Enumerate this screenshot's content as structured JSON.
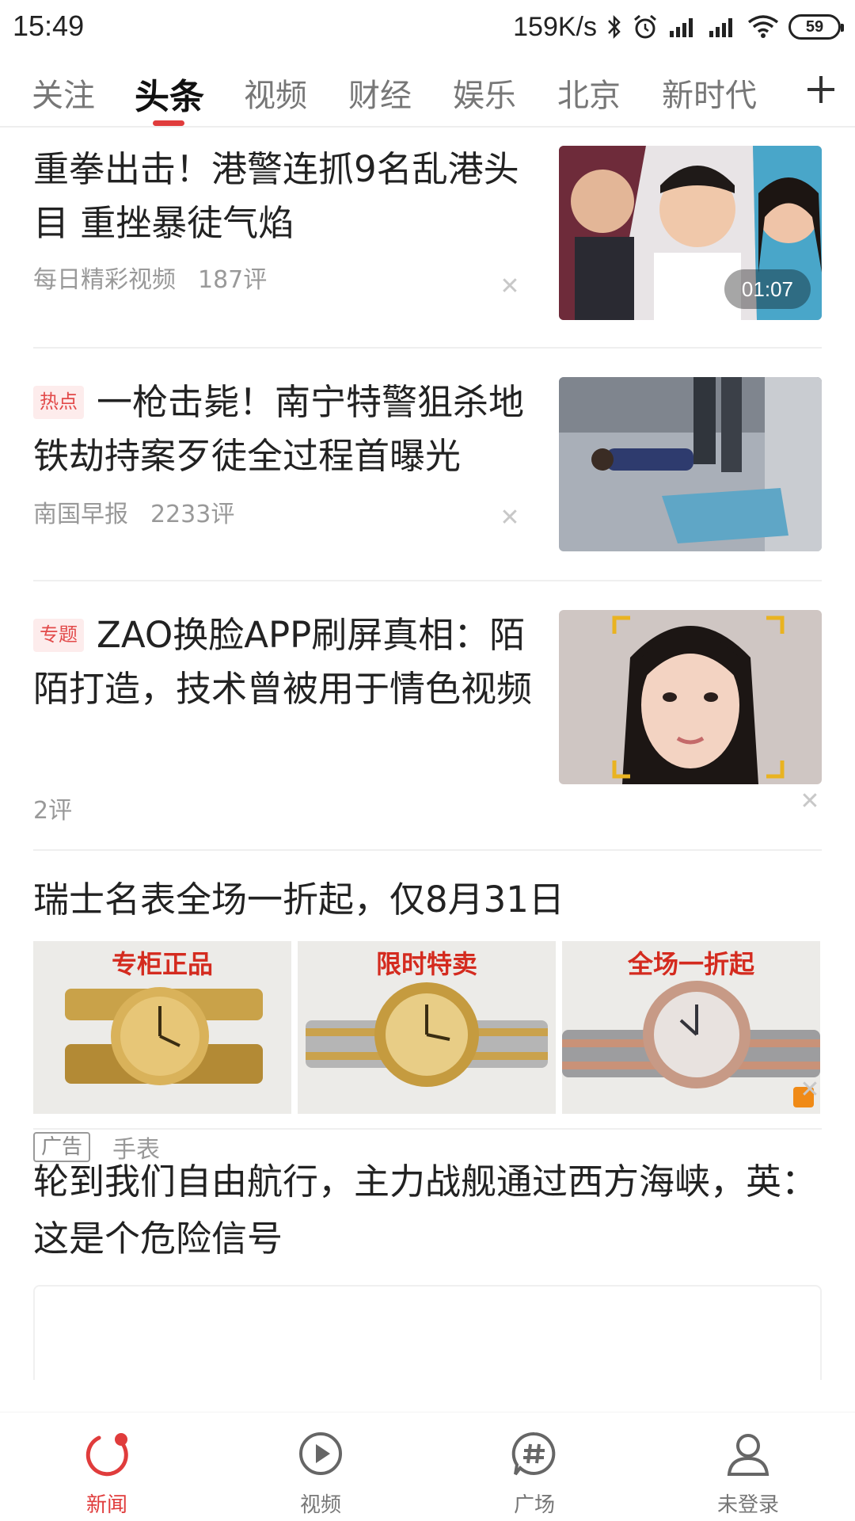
{
  "status_bar": {
    "time": "15:49",
    "net_speed": "159K/s",
    "battery": "59"
  },
  "tabs": [
    {
      "label": "关注",
      "active": false
    },
    {
      "label": "头条",
      "active": true
    },
    {
      "label": "视频",
      "active": false
    },
    {
      "label": "财经",
      "active": false
    },
    {
      "label": "娱乐",
      "active": false
    },
    {
      "label": "北京",
      "active": false
    },
    {
      "label": "新时代",
      "active": false
    }
  ],
  "feed": [
    {
      "title": "重拳出击！港警连抓9名乱港头目 重挫暴徒气焰",
      "tag": "",
      "source": "每日精彩视频",
      "comments": "187评",
      "duration": "01:07"
    },
    {
      "title": "一枪击毙！南宁特警狙杀地铁劫持案歹徒全过程首曝光",
      "tag": "热点",
      "source": "南国早报",
      "comments": "2233评"
    },
    {
      "title": "ZAO换脸APP刷屏真相：陌陌打造，技术曾被用于情色视频",
      "tag": "专题",
      "source": "",
      "comments": "2评"
    }
  ],
  "ad": {
    "title": "瑞士名表全场一折起，仅8月31日",
    "image_labels": [
      "专柜正品",
      "限时特卖",
      "全场一折起"
    ],
    "badge": "广告",
    "category": "手表"
  },
  "last_item": {
    "title": "轮到我们自由航行，主力战舰通过西方海峡，英：这是个危险信号"
  },
  "bottom_nav": [
    {
      "label": "新闻",
      "icon": "refresh-icon",
      "active": true
    },
    {
      "label": "视频",
      "icon": "play-circle-icon",
      "active": false
    },
    {
      "label": "广场",
      "icon": "hashtag-bubble-icon",
      "active": false
    },
    {
      "label": "未登录",
      "icon": "user-icon",
      "active": false
    }
  ],
  "colors": {
    "accent": "#e03c3c",
    "tag_bg": "#fdecec",
    "meta_text": "#999999"
  }
}
